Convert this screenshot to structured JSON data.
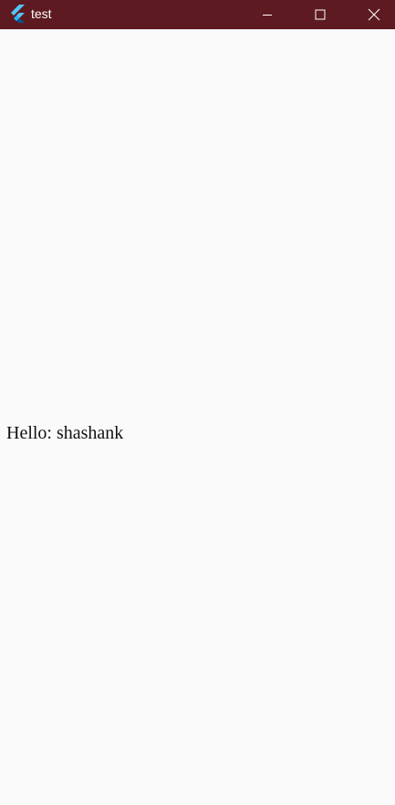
{
  "window": {
    "title": "test",
    "app_icon": "flutter-logo-icon",
    "titlebar_color": "#5d1a20",
    "controls": {
      "minimize": "minimize-icon",
      "maximize": "maximize-icon",
      "close": "close-icon"
    }
  },
  "content": {
    "background_color": "#fafafa",
    "greeting": "Hello: shashank"
  }
}
